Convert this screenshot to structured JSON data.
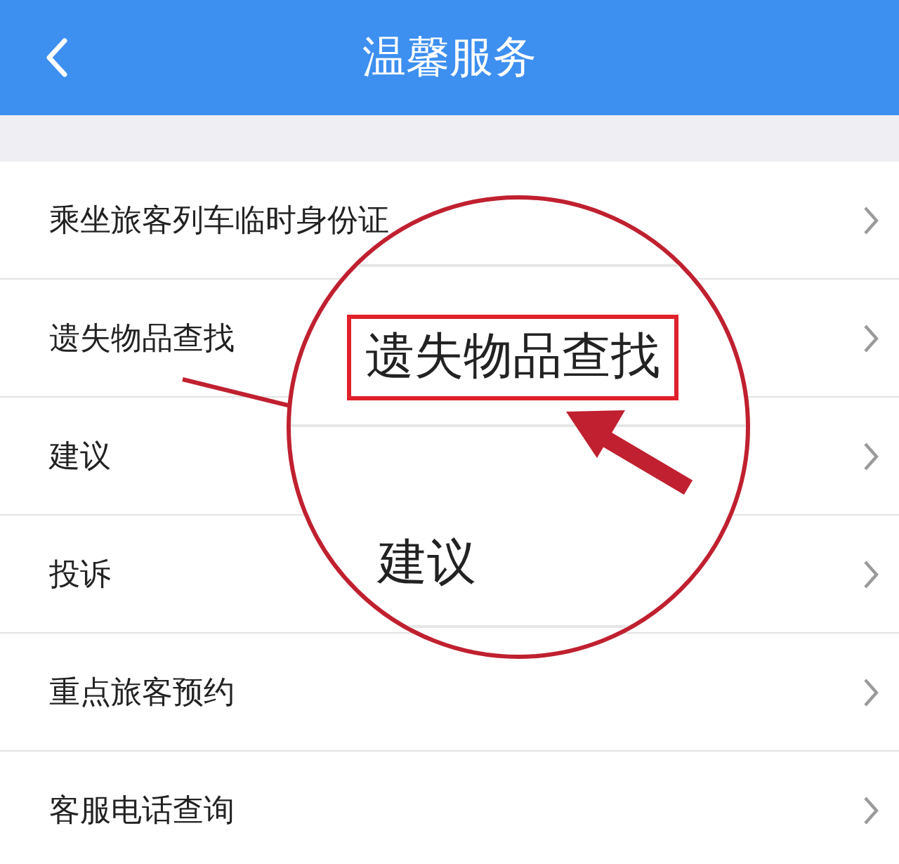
{
  "header": {
    "title": "温馨服务"
  },
  "items": [
    {
      "label": "乘坐旅客列车临时身份证"
    },
    {
      "label": "遗失物品查找"
    },
    {
      "label": "建议"
    },
    {
      "label": "投诉"
    },
    {
      "label": "重点旅客预约"
    },
    {
      "label": "客服电话查询"
    }
  ],
  "magnifier": {
    "items": [
      {
        "label": "遗失物品查找",
        "highlighted": true
      },
      {
        "label": "建议",
        "highlighted": false
      }
    ]
  }
}
